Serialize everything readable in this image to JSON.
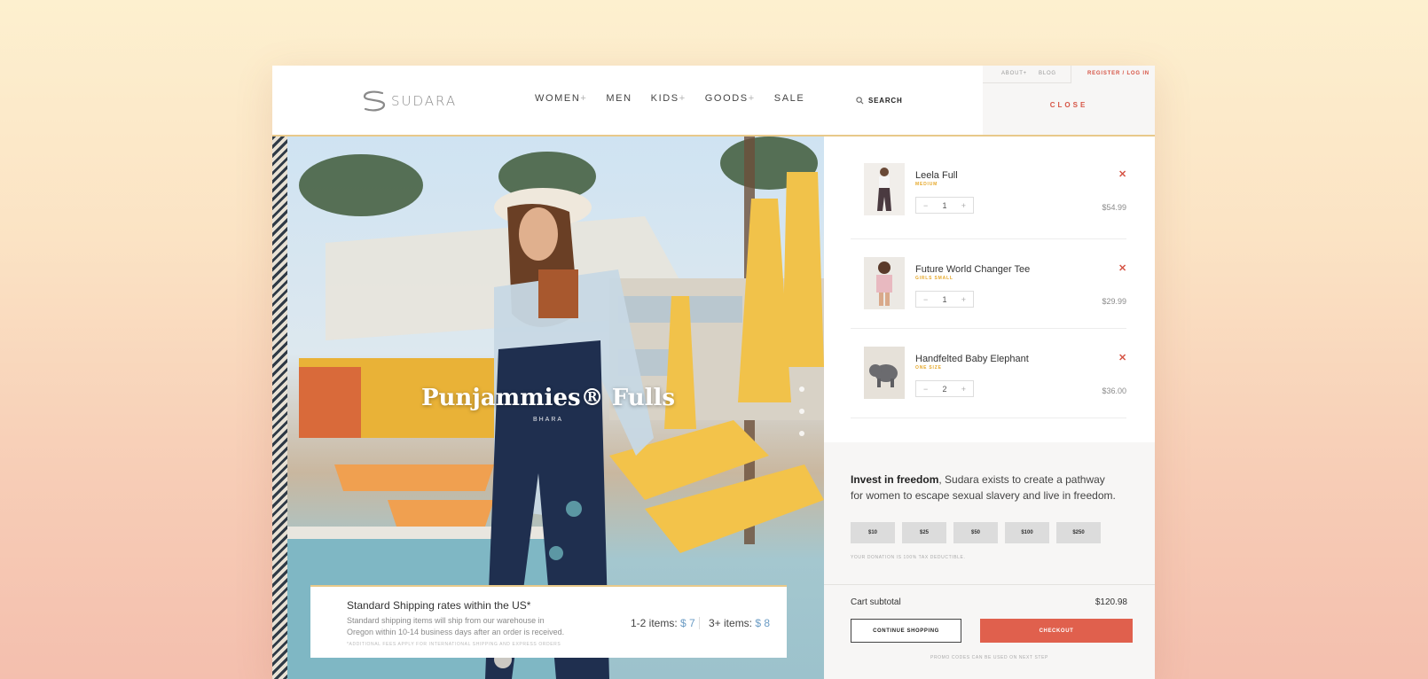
{
  "brand": {
    "name": "SUDARA"
  },
  "nav": {
    "items": [
      {
        "label": "WOMEN",
        "plus": "+"
      },
      {
        "label": "MEN",
        "plus": ""
      },
      {
        "label": "KIDS",
        "plus": "+"
      },
      {
        "label": "GOODS",
        "plus": "+"
      },
      {
        "label": "SALE",
        "plus": ""
      }
    ],
    "search_label": "SEARCH"
  },
  "utility": {
    "about": "ABOUT+",
    "blog": "BLOG",
    "register": "REGISTER / LOG IN",
    "close": "CLOSE"
  },
  "hero": {
    "title": "Punjammies® Fulls",
    "subtitle": "BHARA"
  },
  "shipping": {
    "title": "Standard Shipping rates within the US*",
    "description": "Standard shipping items will ship from our warehouse in Oregon within 10-14 business days after an order is received.",
    "note": "*ADDITIONAL FEES APPLY FOR INTERNATIONAL SHIPPING AND EXPRESS ORDERS",
    "rate1_label": "1-2 items:",
    "rate1_value": "$ 7",
    "rate2_label": "3+ items:",
    "rate2_value": "$ 8"
  },
  "cart": {
    "items": [
      {
        "name": "Leela Full",
        "size": "MEDIUM",
        "qty": "1",
        "price": "$54.99"
      },
      {
        "name": "Future World Changer Tee",
        "size": "GIRLS SMALL",
        "qty": "1",
        "price": "$29.99"
      },
      {
        "name": "Handfelted Baby Elephant",
        "size": "ONE SIZE",
        "qty": "2",
        "price": "$36.00"
      }
    ],
    "minus": "−",
    "plus": "+",
    "remove": "✕"
  },
  "donate": {
    "lead": "Invest in freedom",
    "text": ", Sudara exists to create a pathway for women to escape sexual slavery and live in freedom.",
    "amounts": [
      "$10",
      "$25",
      "$50",
      "$100",
      "$250"
    ],
    "note": "YOUR DONATION IS 100% TAX DEDUCTIBLE."
  },
  "summary": {
    "subtotal_label": "Cart subtotal",
    "subtotal_value": "$120.98",
    "continue_label": "CONTINUE SHOPPING",
    "checkout_label": "CHECKOUT",
    "promo_note": "PROMO CODES CAN BE USED ON NEXT STEP"
  },
  "colors": {
    "accent": "#d65546",
    "checkout": "#e0604d",
    "size_label": "#e6a92c",
    "rate": "#6a9bc4"
  }
}
